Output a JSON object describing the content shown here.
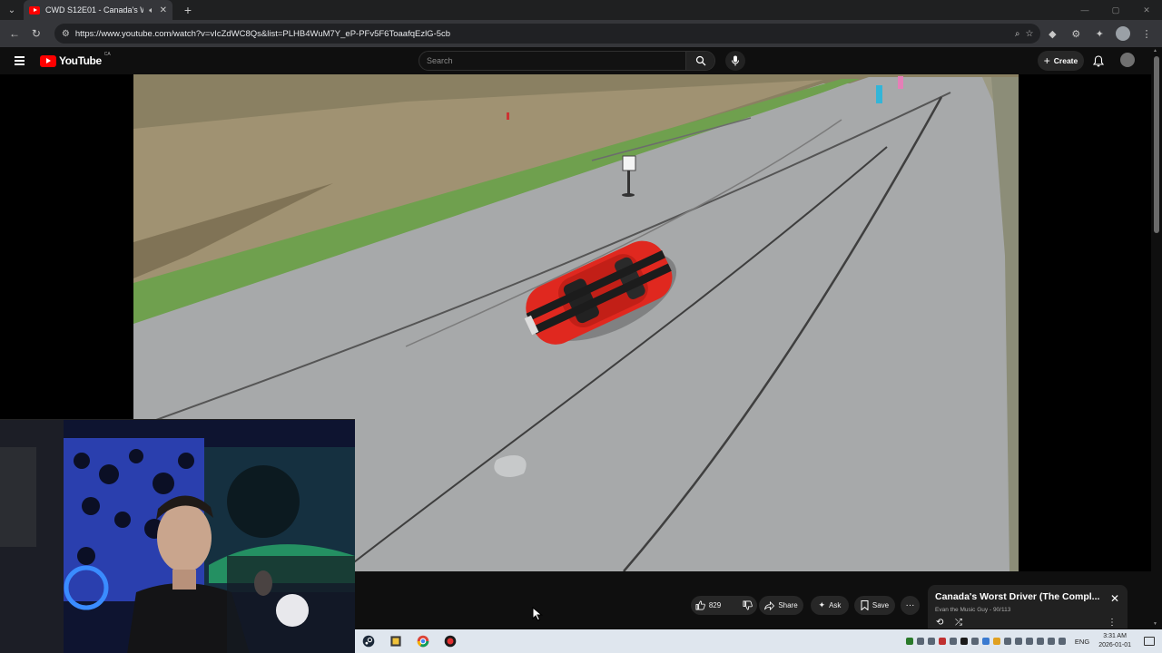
{
  "browser": {
    "tab_title": "CWD S12E01 - Canada's Wo",
    "url": "https://www.youtube.com/watch?v=vIcZdWC8Qs&list=PLHB4WuM7Y_eP-PFv5F6ToaafqEzlG-5cb",
    "new_tab_glyph": "+",
    "tab_close_glyph": "✕"
  },
  "youtube": {
    "logo_text": "YouTube",
    "country_code": "CA",
    "search_placeholder": "Search",
    "create_label": "Create"
  },
  "video_actions": {
    "like_count": "829",
    "share_label": "Share",
    "ask_label": "Ask",
    "save_label": "Save",
    "more_glyph": "···"
  },
  "playlist": {
    "title": "Canada's Worst Driver (The Compl...",
    "subtitle": "Evan the Music Guy - 90/113"
  },
  "taskbar": {
    "language": "ENG",
    "time": "3:31 AM",
    "date": "2026-01-01"
  },
  "colors": {
    "youtube_red": "#ff0000",
    "page_bg": "#0f0f0f",
    "car_red": "#e0281f"
  }
}
